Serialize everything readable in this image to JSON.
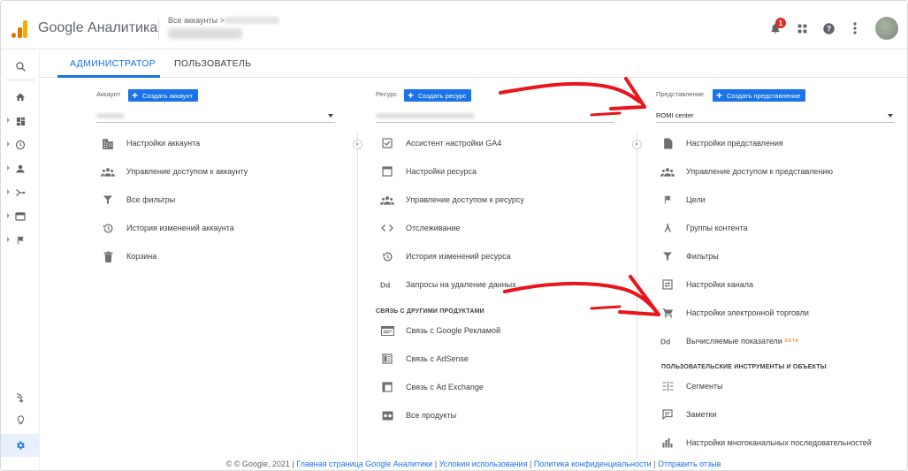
{
  "header": {
    "app_title": "Google Аналитика",
    "breadcrumb": "Все аккаунты >",
    "notification_count": "1"
  },
  "tabs": [
    {
      "label": "АДМИНИСТРАТОР",
      "active": true
    },
    {
      "label": "ПОЛЬЗОВАТЕЛЬ",
      "active": false
    }
  ],
  "account": {
    "label": "Аккаунт",
    "add_label": "Создать аккаунт",
    "items": [
      {
        "icon": "building-icon",
        "label": "Настройки аккаунта"
      },
      {
        "icon": "people-icon",
        "label": "Управление доступом к аккаунту"
      },
      {
        "icon": "filter-icon",
        "label": "Все фильтры"
      },
      {
        "icon": "history-icon",
        "label": "История изменений аккаунта"
      },
      {
        "icon": "trash-icon",
        "label": "Корзина"
      }
    ]
  },
  "property": {
    "label": "Ресурс",
    "add_label": "Создать ресурс",
    "items": [
      {
        "icon": "checkbox-icon",
        "label": "Ассистент настройки GA4"
      },
      {
        "icon": "window-icon",
        "label": "Настройки ресурса"
      },
      {
        "icon": "people-icon",
        "label": "Управление доступом к ресурсу"
      },
      {
        "icon": "code-icon",
        "label": "Отслеживание"
      },
      {
        "icon": "history-icon",
        "label": "История изменений ресурса"
      },
      {
        "icon": "dd-icon",
        "label": "Запросы на удаление данных"
      }
    ],
    "section_title": "СВЯЗЬ С ДРУГИМИ ПРОДУКТАМИ",
    "links": [
      {
        "icon": "ads-icon",
        "label": "Связь с Google Рекламой"
      },
      {
        "icon": "adsense-icon",
        "label": "Связь с AdSense"
      },
      {
        "icon": "adexchange-icon",
        "label": "Связь с Ad Exchange"
      },
      {
        "icon": "products-icon",
        "label": "Все продукты"
      }
    ]
  },
  "view": {
    "label": "Представление",
    "add_label": "Создать представление",
    "selected": "ROMI center",
    "items": [
      {
        "icon": "document-icon",
        "label": "Настройки представления"
      },
      {
        "icon": "people-icon",
        "label": "Управление доступом к представлению"
      },
      {
        "icon": "flag-icon",
        "label": "Цели"
      },
      {
        "icon": "content-groups-icon",
        "label": "Группы контента"
      },
      {
        "icon": "filter-icon",
        "label": "Фильтры"
      },
      {
        "icon": "channel-settings-icon",
        "label": "Настройки канала"
      },
      {
        "icon": "cart-icon",
        "label": "Настройки электронной торговли"
      },
      {
        "icon": "dd-icon",
        "label": "Вычисляемые показатели",
        "badge": "БЕТА"
      }
    ],
    "section_title": "ПОЛЬЗОВАТЕЛЬСКИЕ ИНСТРУМЕНТЫ И ОБЪЕКТЫ",
    "tools": [
      {
        "icon": "segments-icon",
        "label": "Сегменты"
      },
      {
        "icon": "notes-icon",
        "label": "Заметки"
      },
      {
        "icon": "multichannel-icon",
        "label": "Настройки многоканальных последовательностей"
      }
    ]
  },
  "footer": {
    "copyright": "© © Google, 2021 |",
    "links": [
      "Главная страница Google Аналитики",
      "Условия использования",
      "Политика конфиденциальности",
      "Отправить отзыв"
    ],
    "separator": "|"
  },
  "colors": {
    "accent": "#1a73e8",
    "arrow": "#e8151b",
    "logo_orange": "#e37400",
    "logo_yellow": "#f9ab00"
  }
}
